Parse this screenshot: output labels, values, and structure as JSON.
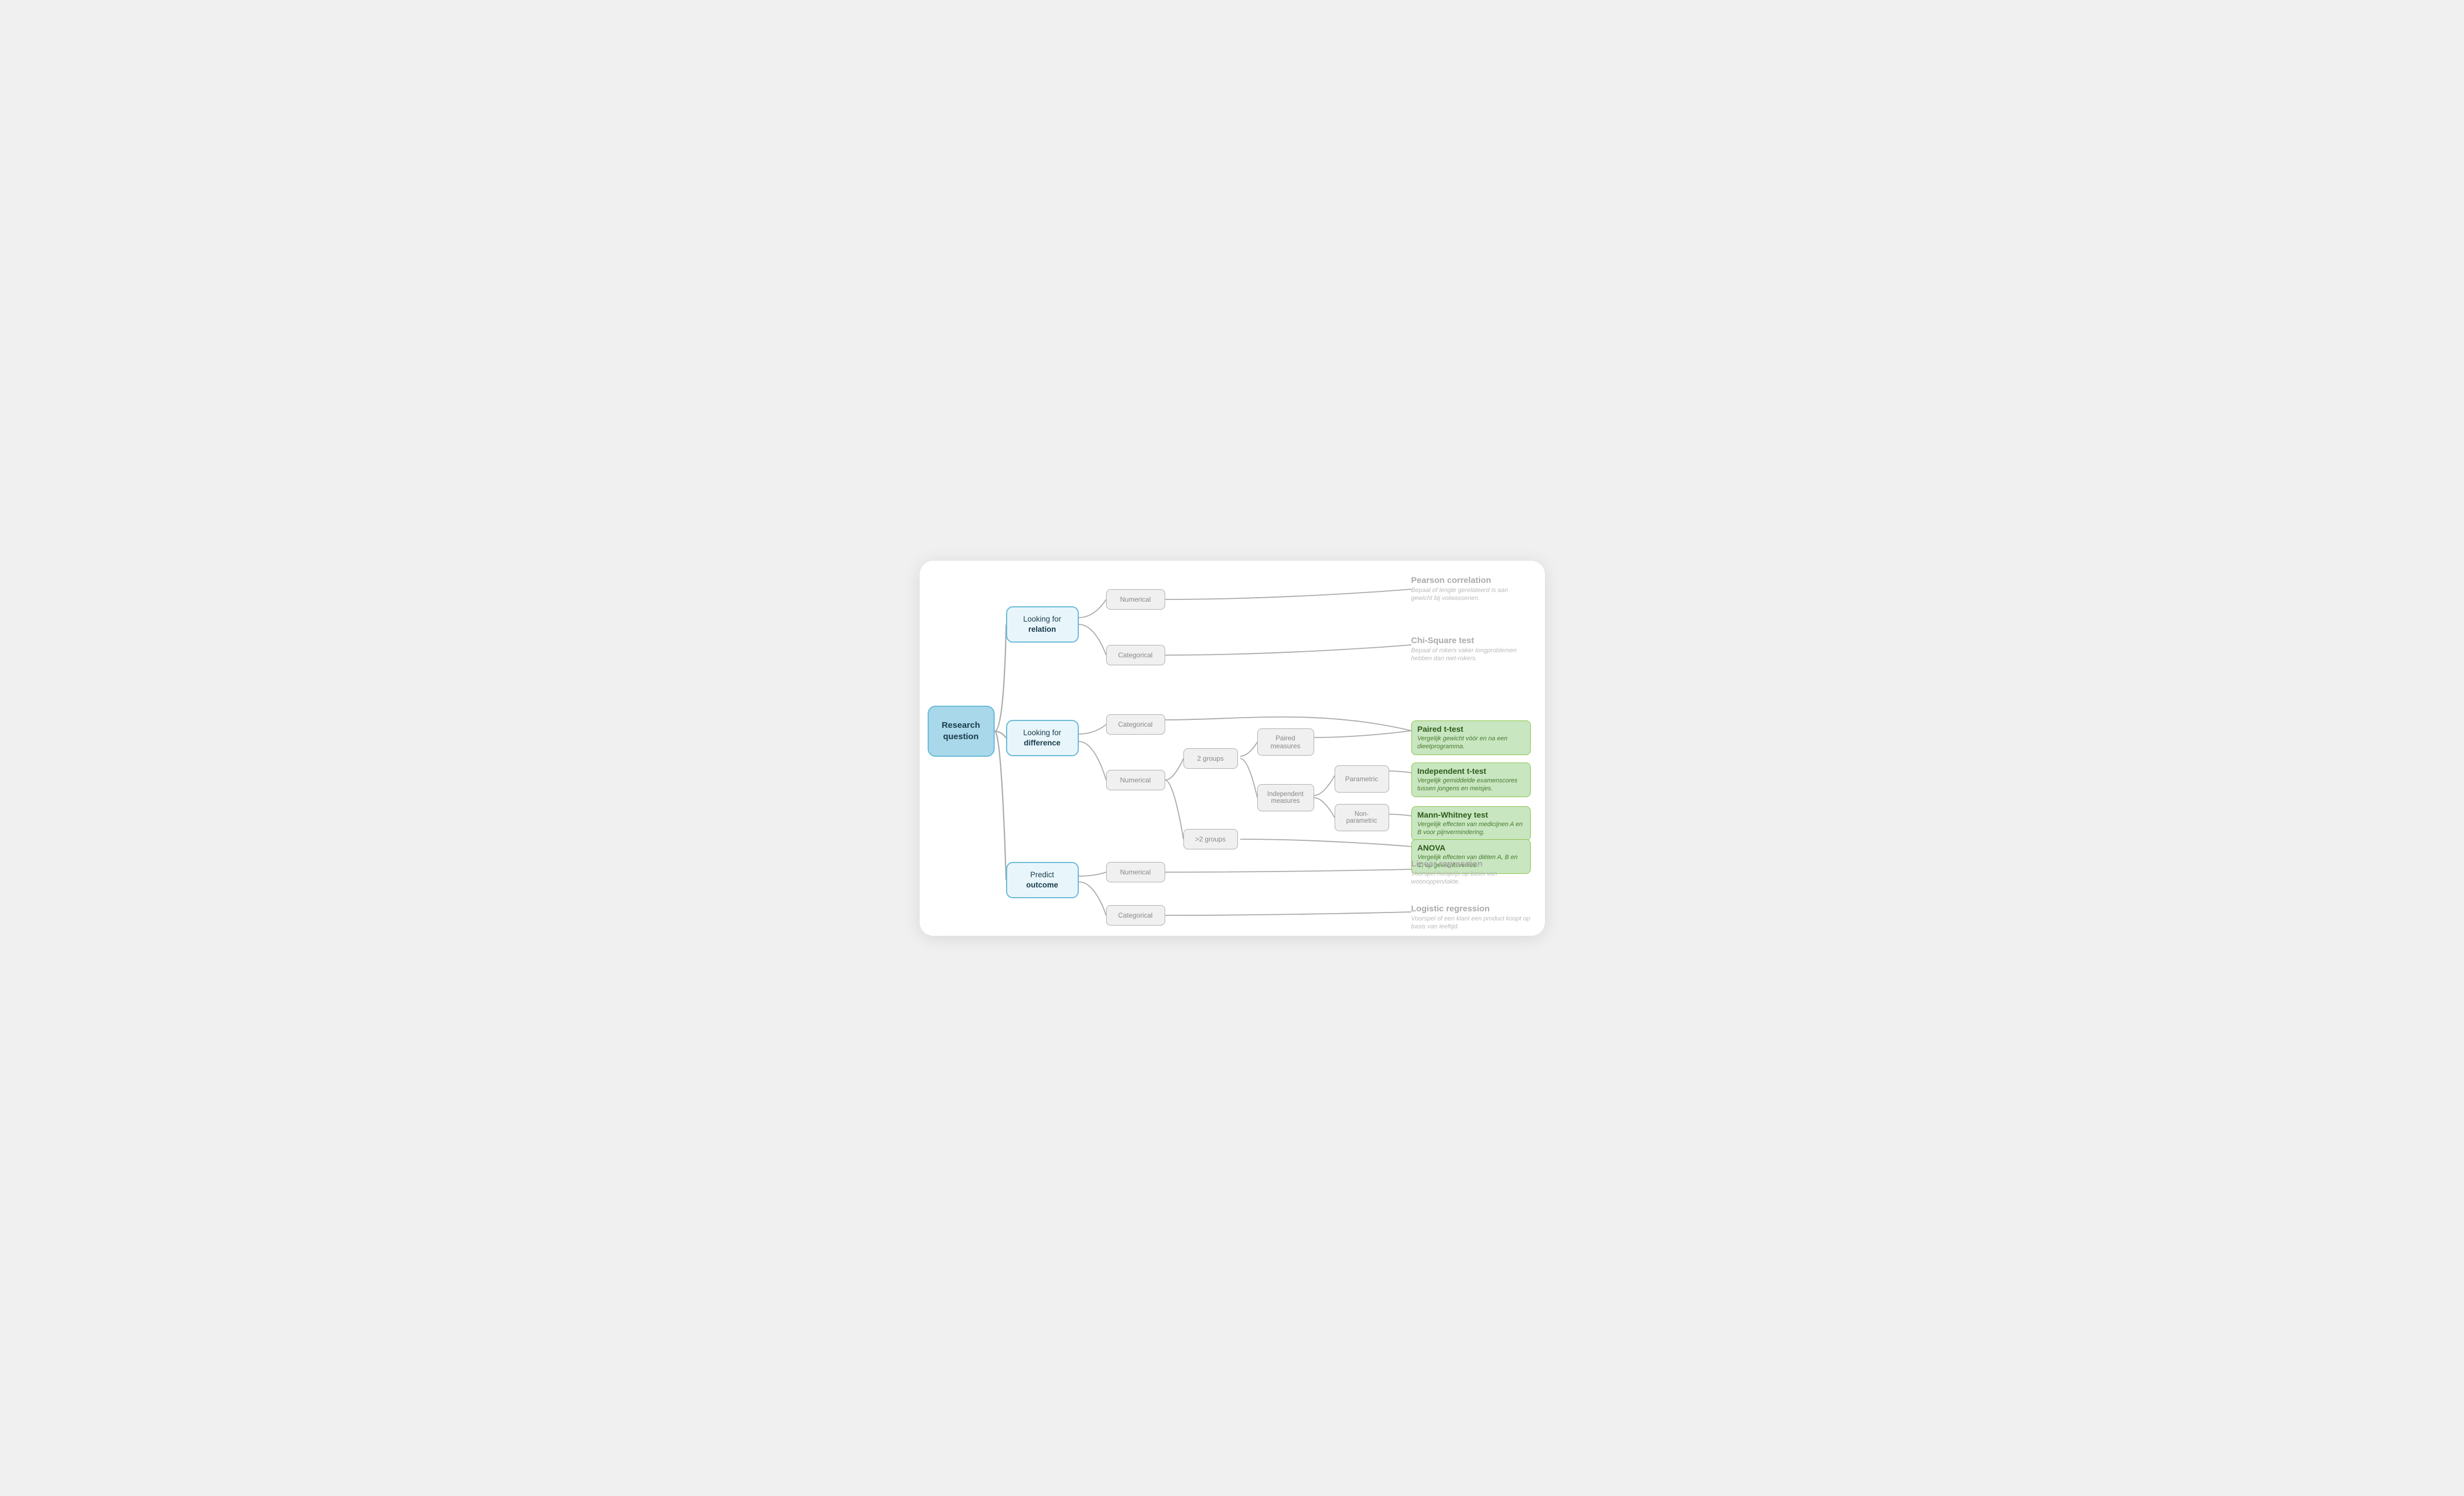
{
  "nodes": {
    "research": {
      "label": "Research\nquestion"
    },
    "relation": {
      "line1": "Looking for",
      "line2": "relation"
    },
    "difference": {
      "line1": "Looking for",
      "line2": "difference"
    },
    "predict": {
      "line1": "Predict",
      "line2": "outcome"
    },
    "num_rel": "Numerical",
    "cat_rel": "Categorical",
    "cat_diff": "Categorical",
    "num_diff": "Numerical",
    "two_groups": "2 groups",
    "gt2_groups": ">2 groups",
    "paired": "Paired\nmeasures",
    "independent": "Independent\nmeasures",
    "parametric": "Parametric",
    "nonparametric": "Non-\nparametric",
    "num_pred": "Numerical",
    "cat_pred": "Categorical"
  },
  "results": {
    "pearson": {
      "title": "Pearson correlation",
      "desc": "Bepaal of lengte gerelateerd is aan gewicht bij volwassenen.",
      "style": "gray"
    },
    "chi": {
      "title": "Chi-Square test",
      "desc": "Bepaal of rokers vaker longproblemen hebben dan niet-rokers.",
      "style": "gray"
    },
    "paired_t": {
      "title": "Paired t-test",
      "desc": "Vergelijk gewicht vóór en na een dieetprogramma.",
      "style": "green"
    },
    "indep_t": {
      "title": "Independent t-test",
      "desc": "Vergelijk gemiddelde examenscores tussen jongens en meisjes.",
      "style": "green"
    },
    "mann": {
      "title": "Mann-Whitney test",
      "desc": "Vergelijk effecten van medicijnen A en B voor pijnvermindering.",
      "style": "green"
    },
    "anova": {
      "title": "ANOVA",
      "desc": "Vergelijk effecten van diëten A, B en C, op gewichtsverlies.",
      "style": "green"
    },
    "linear": {
      "title": "Linear regression",
      "desc": "Voorspel huisprijs op basis van woonoppervlakte.",
      "style": "gray"
    },
    "logistic": {
      "title": "Logistic regression",
      "desc": "Voorspel of een klant een product koopt op basis van leeftijd.",
      "style": "gray"
    }
  }
}
